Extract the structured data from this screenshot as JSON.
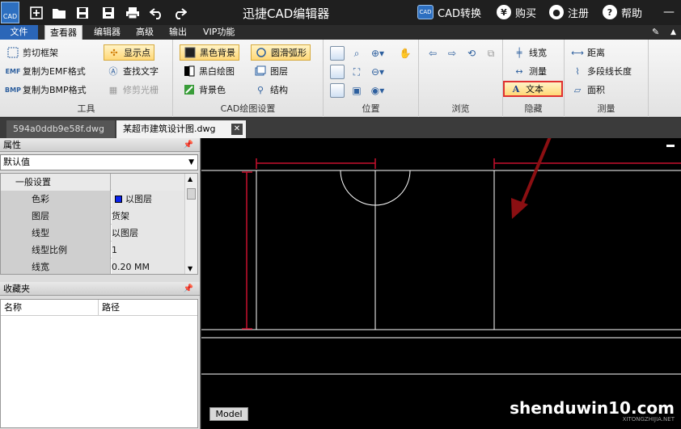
{
  "titlebar": {
    "title": "迅捷CAD编辑器",
    "logo_text": "CAD",
    "cad_convert": "CAD转换",
    "buy": "购买",
    "register": "注册",
    "help": "帮助"
  },
  "menu": {
    "file": "文件",
    "viewer": "查看器",
    "editor": "编辑器",
    "advanced": "高级",
    "output": "输出",
    "vip": "VIP功能"
  },
  "ribbon": {
    "tools": {
      "label": "工具",
      "clip_frame": "剪切框架",
      "copy_emf": "复制为EMF格式",
      "copy_bmp": "复制为BMP格式",
      "show_points": "显示点",
      "find_text": "查找文字",
      "trim_raster": "修剪光栅"
    },
    "cad_settings": {
      "label": "CAD绘图设置",
      "black_bg": "黑色背景",
      "bw_draw": "黑白绘图",
      "bg_color": "背景色",
      "smooth_arc": "圆滑弧形",
      "layers": "图层",
      "structure": "结构"
    },
    "position": {
      "label": "位置"
    },
    "browse": {
      "label": "浏览"
    },
    "hide": {
      "label": "隐藏",
      "line_width": "线宽",
      "measure": "测量",
      "text": "文本"
    },
    "measure": {
      "label": "测量",
      "distance": "距离",
      "polyline_length": "多段线长度",
      "area": "面积"
    }
  },
  "doc_tabs": {
    "tab1": "594a0ddb9e58f.dwg",
    "tab2": "某超市建筑设计图.dwg",
    "close": "✕"
  },
  "properties": {
    "header": "属性",
    "selector": "默认值",
    "category": "一般设置",
    "rows": [
      {
        "key": "色彩",
        "value": "以图层"
      },
      {
        "key": "图层",
        "value": "货架"
      },
      {
        "key": "线型",
        "value": "以图层"
      },
      {
        "key": "线型比例",
        "value": "1"
      },
      {
        "key": "线宽",
        "value": "0.20 MM"
      }
    ]
  },
  "favorites": {
    "header": "收藏夹",
    "col_name": "名称",
    "col_path": "路径"
  },
  "drawing": {
    "model_tab": "Model",
    "watermark": "shenduwin10.com",
    "watermark_sub": "XITONGZHIJIA.NET"
  },
  "colors": {
    "accent_blue": "#2b66b8",
    "dimension_red": "#c8102e",
    "highlight_box": "#e03030",
    "arrow_dark_red": "#8b0f12"
  }
}
